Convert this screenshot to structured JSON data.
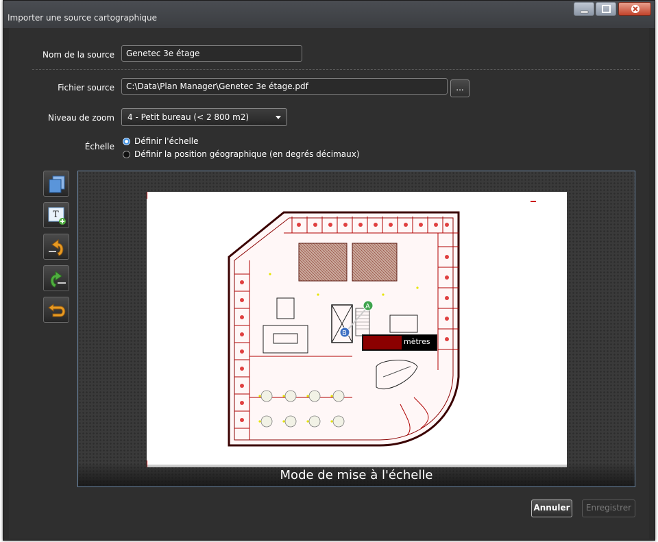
{
  "window": {
    "title": "Importer une source cartographique",
    "controls": [
      "minimize-icon",
      "maximize-icon",
      "close-icon"
    ]
  },
  "form": {
    "source_name_label": "Nom de la source",
    "source_name_value": "Genetec 3e étage",
    "source_file_label": "Fichier source",
    "source_file_value": "C:\\Data\\Plan Manager\\Genetec 3e étage.pdf",
    "browse_label": "...",
    "zoom_label": "Niveau de zoom",
    "zoom_value": "4 - Petit bureau (< 2 800 m2)",
    "scale_label": "Échelle",
    "scale_options": [
      {
        "label": "Définir l'échelle",
        "selected": true
      },
      {
        "label": "Définir la position géographique (en degrés décimaux)",
        "selected": false
      }
    ]
  },
  "toolbar": {
    "tools": [
      "copy-pages-icon",
      "insert-text-icon",
      "rotate-left-icon",
      "rotate-right-icon",
      "undo-icon"
    ]
  },
  "preview": {
    "marker_a": "A",
    "marker_b": "B",
    "scale_unit": "mètres",
    "mode_label": "Mode de mise à l'échelle"
  },
  "footer": {
    "cancel_label": "Annuler",
    "save_label": "Enregistrer"
  },
  "colors": {
    "accent": "#3d8fe0",
    "floorplan_lines": "#8b0000",
    "scale_bar": "#8b0000",
    "marker_a": "#3fa34d",
    "marker_b": "#3d6fc2"
  }
}
